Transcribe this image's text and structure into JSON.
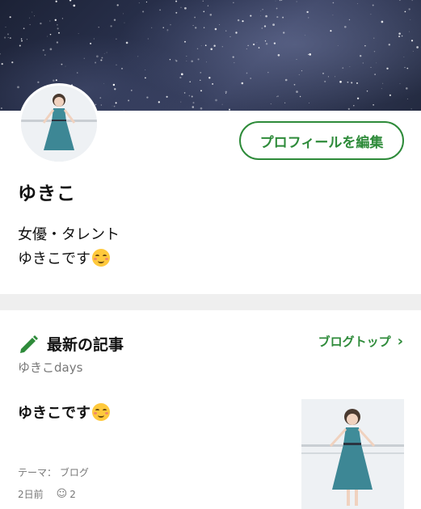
{
  "profile": {
    "name": "ゆきこ",
    "edit_button": "プロフィールを編集",
    "bio_line1": "女優・タレント",
    "bio_line2": "ゆきこです"
  },
  "latest": {
    "section_title": "最新の記事",
    "blog_top": "ブログトップ",
    "blog_name": "ゆきこdays",
    "article": {
      "title": "ゆきこです",
      "theme_label": "テーマ：",
      "theme_value": "ブログ",
      "time": "2日前",
      "likes": "2"
    }
  },
  "icons": {
    "pencil": "pencil-icon",
    "chevron": "chevron-right-icon",
    "emoji": "smiling-face-emoji",
    "reaction": "smile-icon"
  },
  "colors": {
    "accent": "#2e8b3a",
    "divider": "#efefef"
  }
}
